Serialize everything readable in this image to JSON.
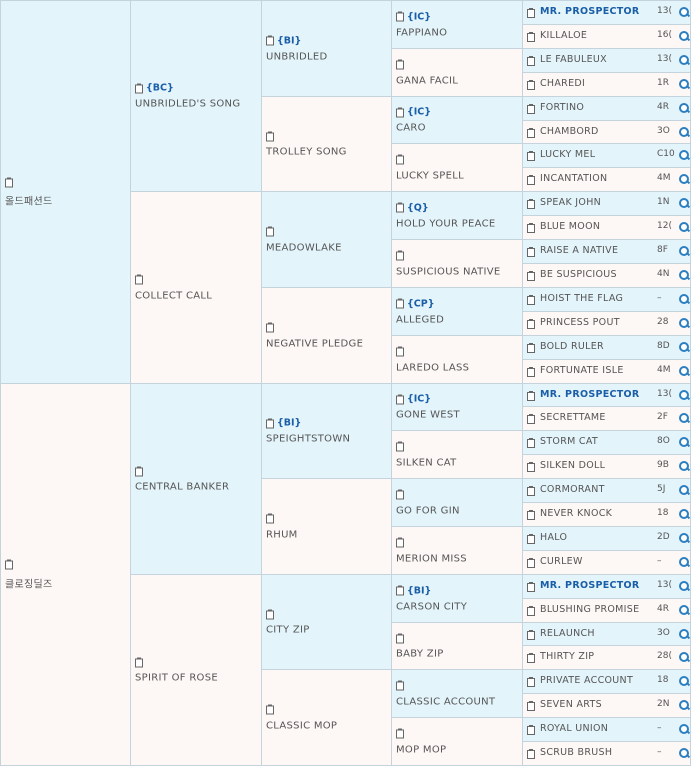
{
  "gen1": [
    {
      "name": "올드패션드"
    },
    {
      "name": "클로징딜즈"
    }
  ],
  "gen2": [
    {
      "name": "UNBRIDLED'S SONG",
      "tag": "{BC}"
    },
    {
      "name": "COLLECT CALL"
    },
    {
      "name": "CENTRAL BANKER"
    },
    {
      "name": "SPIRIT OF ROSE"
    }
  ],
  "gen3": [
    {
      "name": "UNBRIDLED",
      "tag": "{BI}"
    },
    {
      "name": "TROLLEY SONG"
    },
    {
      "name": "MEADOWLAKE"
    },
    {
      "name": "NEGATIVE PLEDGE"
    },
    {
      "name": "SPEIGHTSTOWN",
      "tag": "{BI}"
    },
    {
      "name": "RHUM"
    },
    {
      "name": "CITY ZIP"
    },
    {
      "name": "CLASSIC MOP"
    }
  ],
  "gen4": [
    {
      "name": "FAPPIANO",
      "tag": "{IC}"
    },
    {
      "name": "GANA FACIL"
    },
    {
      "name": "CARO",
      "tag": "{IC}"
    },
    {
      "name": "LUCKY SPELL"
    },
    {
      "name": "HOLD YOUR PEACE",
      "tag": "{Q}"
    },
    {
      "name": "SUSPICIOUS NATIVE"
    },
    {
      "name": "ALLEGED",
      "tag": "{CP}"
    },
    {
      "name": "LAREDO LASS"
    },
    {
      "name": "GONE WEST",
      "tag": "{IC}"
    },
    {
      "name": "SILKEN CAT"
    },
    {
      "name": "GO FOR GIN"
    },
    {
      "name": "MERION MISS"
    },
    {
      "name": "CARSON CITY",
      "tag": "{BI}"
    },
    {
      "name": "BABY ZIP"
    },
    {
      "name": "CLASSIC ACCOUNT"
    },
    {
      "name": "MOP MOP"
    }
  ],
  "gen5": [
    {
      "name": "MR. PROSPECTOR",
      "rec": "13(",
      "bold": true
    },
    {
      "name": "KILLALOE",
      "rec": "16("
    },
    {
      "name": "LE FABULEUX",
      "rec": "13("
    },
    {
      "name": "CHAREDI",
      "rec": "1R"
    },
    {
      "name": "FORTINO",
      "rec": "4R"
    },
    {
      "name": "CHAMBORD",
      "rec": "3O"
    },
    {
      "name": "LUCKY MEL",
      "rec": "C10"
    },
    {
      "name": "INCANTATION",
      "rec": "4M"
    },
    {
      "name": "SPEAK JOHN",
      "rec": "1N"
    },
    {
      "name": "BLUE MOON",
      "rec": "12("
    },
    {
      "name": "RAISE A NATIVE",
      "rec": "8F"
    },
    {
      "name": "BE SUSPICIOUS",
      "rec": "4N"
    },
    {
      "name": "HOIST THE FLAG",
      "rec": "–"
    },
    {
      "name": "PRINCESS POUT",
      "rec": "28"
    },
    {
      "name": "BOLD RULER",
      "rec": "8D"
    },
    {
      "name": "FORTUNATE ISLE",
      "rec": "4M"
    },
    {
      "name": "MR. PROSPECTOR",
      "rec": "13(",
      "bold": true
    },
    {
      "name": "SECRETTAME",
      "rec": "2F"
    },
    {
      "name": "STORM CAT",
      "rec": "8O"
    },
    {
      "name": "SILKEN DOLL",
      "rec": "9B"
    },
    {
      "name": "CORMORANT",
      "rec": "5J"
    },
    {
      "name": "NEVER KNOCK",
      "rec": "18"
    },
    {
      "name": "HALO",
      "rec": "2D"
    },
    {
      "name": "CURLEW",
      "rec": "–"
    },
    {
      "name": "MR. PROSPECTOR",
      "rec": "13(",
      "bold": true
    },
    {
      "name": "BLUSHING PROMISE",
      "rec": "4R"
    },
    {
      "name": "RELAUNCH",
      "rec": "3O"
    },
    {
      "name": "THIRTY ZIP",
      "rec": "28("
    },
    {
      "name": "PRIVATE ACCOUNT",
      "rec": "18"
    },
    {
      "name": "SEVEN ARTS",
      "rec": "2N"
    },
    {
      "name": "ROYAL UNION",
      "rec": "–"
    },
    {
      "name": "SCRUB BRUSH",
      "rec": "–"
    }
  ],
  "icons": {
    "clip": "clipboard-icon",
    "search": "search-icon"
  },
  "colors": {
    "sire_bg": "#e3f4fb",
    "dam_bg": "#fdf7f5",
    "tag": "#1a5ea8",
    "border": "#c5d3dc"
  }
}
